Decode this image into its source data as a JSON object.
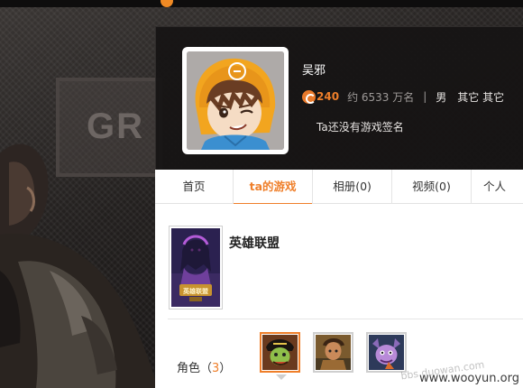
{
  "profile": {
    "name": "吴邪",
    "coins": "240",
    "rank": "约 6533 万名",
    "separator": "|",
    "gender": "男",
    "tags": "其它 其它",
    "signature": "Ta还没有游戏签名"
  },
  "tabs": {
    "home": "首页",
    "games": "ta的游戏",
    "photos": "相册(0)",
    "videos": "视频(0)",
    "more": "个人"
  },
  "game": {
    "title": "英雄联盟",
    "cover_caption": "英雄联盟"
  },
  "roles": {
    "label": "角色（",
    "count": "3",
    "label_end": "）"
  },
  "watermark": {
    "main": "www.wooyun.org",
    "faint": "bbs.duowan.com"
  },
  "background": {
    "sign_text": "GR"
  },
  "colors": {
    "accent": "#ef7f2a",
    "header_bg": "#161414",
    "tab_active": "#ef7f2a"
  },
  "icons": [
    "coin-icon",
    "role-pointer-icon"
  ]
}
